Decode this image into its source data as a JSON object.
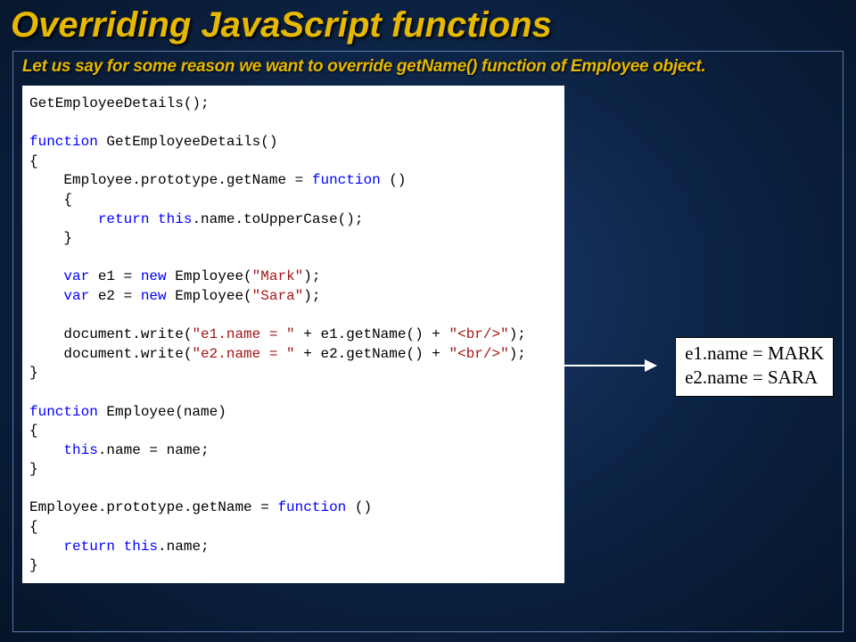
{
  "title": "Overriding JavaScript functions",
  "subtitle": "Let us say for some reason we want to override getName() function of Employee object.",
  "code": {
    "l1": "GetEmployeeDetails();",
    "l2_kw": "function",
    "l2_rest": " GetEmployeeDetails()",
    "l3": "{",
    "l4a": "    Employee.prototype.getName = ",
    "l4_kw": "function",
    "l4b": " ()",
    "l5": "    {",
    "l6_pad": "        ",
    "l6_kw": "return",
    "l6_rest": " ",
    "l6_kw2": "this",
    "l6_rest2": ".name.toUpperCase();",
    "l7": "    }",
    "l8_pad": "    ",
    "l8_kw": "var",
    "l8a": " e1 = ",
    "l8_kw2": "new",
    "l8b": " Employee(",
    "l8_str": "\"Mark\"",
    "l8c": ");",
    "l9_pad": "    ",
    "l9_kw": "var",
    "l9a": " e2 = ",
    "l9_kw2": "new",
    "l9b": " Employee(",
    "l9_str": "\"Sara\"",
    "l9c": ");",
    "l10a": "    document.write(",
    "l10_str1": "\"e1.name = \"",
    "l10b": " + e1.getName() + ",
    "l10_str2": "\"<br/>\"",
    "l10c": ");",
    "l11a": "    document.write(",
    "l11_str1": "\"e2.name = \"",
    "l11b": " + e2.getName() + ",
    "l11_str2": "\"<br/>\"",
    "l11c": ");",
    "l12": "}",
    "l13_kw": "function",
    "l13_rest": " Employee(name)",
    "l14": "{",
    "l15_pad": "    ",
    "l15_kw": "this",
    "l15_rest": ".name = name;",
    "l16": "}",
    "l17a": "Employee.prototype.getName = ",
    "l17_kw": "function",
    "l17b": " ()",
    "l18": "{",
    "l19_pad": "    ",
    "l19_kw": "return",
    "l19_rest": " ",
    "l19_kw2": "this",
    "l19_rest2": ".name;",
    "l20": "}"
  },
  "output": {
    "line1": "e1.name = MARK",
    "line2": "e2.name = SARA"
  }
}
